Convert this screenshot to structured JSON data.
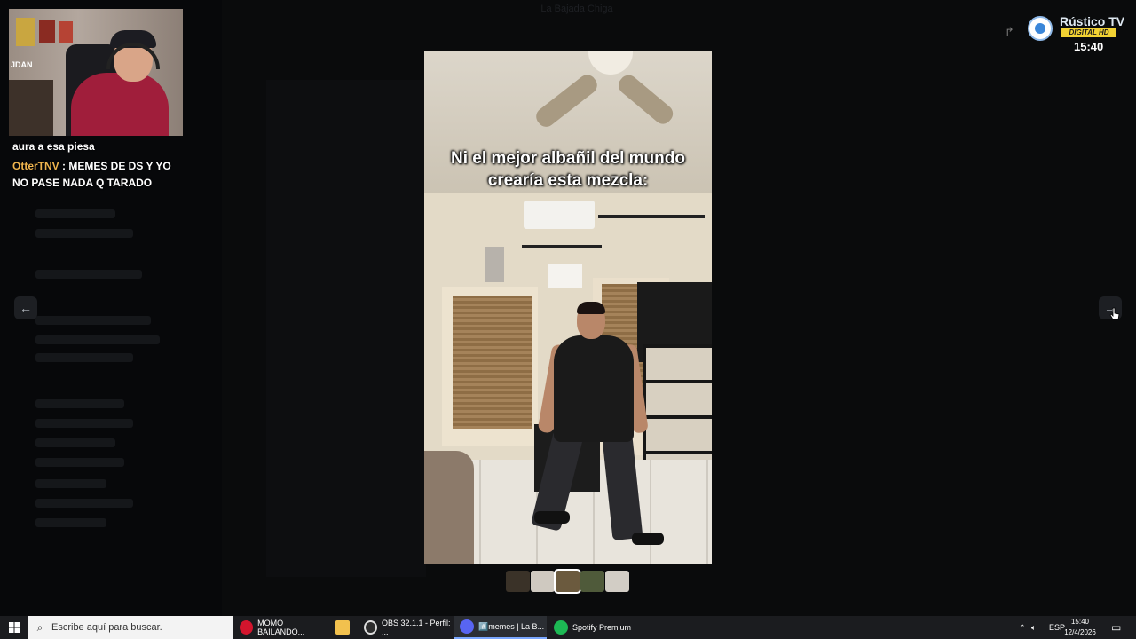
{
  "window": {
    "title": "La Bajada Chiga"
  },
  "stream": {
    "chat_lines": [
      {
        "user": "",
        "text": "aura a esa piesa"
      },
      {
        "user": "OtterTNV",
        "text": " : MEMES DE DS Y YO NO PASE NADA Q TARADO"
      }
    ],
    "cam_label": "JDAN"
  },
  "viewer": {
    "prev_label": "←",
    "next_label": "→",
    "caption": "Ni el mejor albañil del mundo\ncrearía esta mezcla:",
    "thumbnail_count": 5,
    "selected_thumbnail": 3
  },
  "broadcast_logo": {
    "name": "Rústico TV",
    "badge": "DIGITAL HD",
    "time": "15:40"
  },
  "taskbar": {
    "start_icon": "windows-icon",
    "search_placeholder": "Escribe aquí para buscar.",
    "items": [
      {
        "label": "MOMO BAILANDO...",
        "icon": "opera-icon",
        "color": "#d3152d"
      },
      {
        "label": "",
        "icon": "file-explorer-icon",
        "color": "#f2c14e"
      },
      {
        "label": "OBS 32.1.1 - Perfil: ...",
        "icon": "obs-icon",
        "color": "#2d2d2d"
      },
      {
        "label": "#️⃣memes | La B...",
        "icon": "discord-icon",
        "color": "#5865f2"
      },
      {
        "label": "Spotify Premium",
        "icon": "spotify-icon",
        "color": "#1db954"
      }
    ],
    "tray": {
      "lang": "ESP",
      "time": "15:40",
      "date": "12/4/2026"
    }
  }
}
